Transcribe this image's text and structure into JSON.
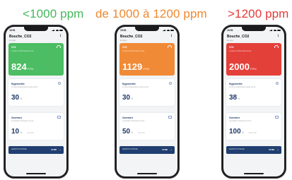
{
  "columns": [
    {
      "heading": "<1000 ppm",
      "heading_color": "#43b85b",
      "co2_color": "#4cbd62",
      "co2_value": "824",
      "ventilation_value": "10",
      "ventilation_extra": "10 m³/h",
      "bottom_value": "00 MIN"
    },
    {
      "heading": "de 1000 à 1200 ppm",
      "heading_color": "#f0872e",
      "co2_color": "#f18a36",
      "co2_value": "1129",
      "ventilation_value": "50",
      "ventilation_extra": "50 m³/h",
      "bottom_value": "00 MIN"
    },
    {
      "heading": ">1200 ppm",
      "heading_color": "#e43a37",
      "co2_color": "#e4403a",
      "co2_value": "2000",
      "ventilation_value": "100",
      "ventilation_extra": "100 m³/h",
      "bottom_value": "00 MIN"
    }
  ],
  "phone": {
    "time": "15:51",
    "title": "Bouche_CO2",
    "subtitle": "En ligne",
    "kebab": "⋮",
    "co2_label": "CO2",
    "co2_desc": "Le taux de CO2 relevé est de :",
    "co2_unit": "PPM",
    "humidity_label": "Hygrométrie",
    "humidity_desc": "Le taux d'hygrométrie relevé est de :",
    "humidity_values": [
      "30",
      "30",
      "38"
    ],
    "humidity_unit": "%",
    "ventilation_label": "Ouverture",
    "ventilation_desc": "La position d'ouverture est de :",
    "ventilation_unit": "%",
    "bottom_label": "AERATION FORCÉE",
    "bottom_arrow": "→"
  }
}
